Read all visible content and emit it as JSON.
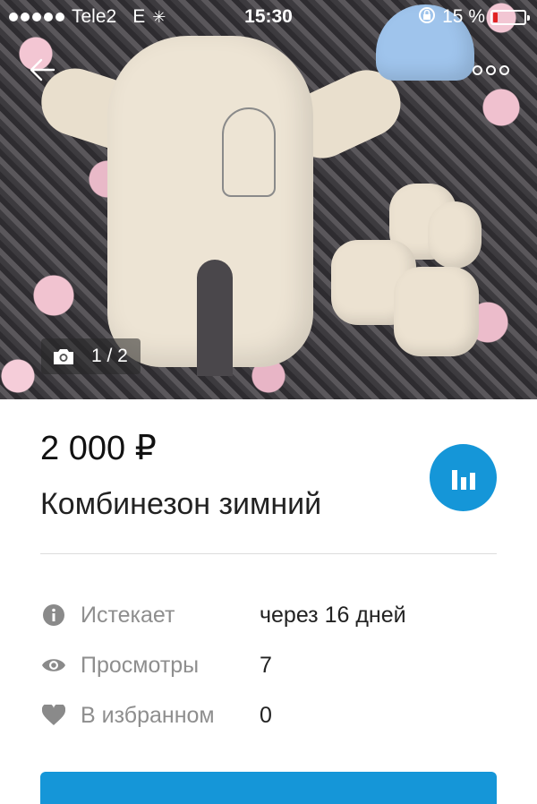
{
  "status_bar": {
    "carrier": "Tele2",
    "network": "E",
    "time": "15:30",
    "battery_percent_text": "15 %",
    "battery_level": 0.15,
    "signal_bars": 5
  },
  "photo": {
    "counter": "1 / 2"
  },
  "listing": {
    "price": "2 000 ₽",
    "title": "Комбинезон зимний"
  },
  "stats": [
    {
      "icon": "info-icon",
      "label": "Истекает",
      "value": "через 16 дней"
    },
    {
      "icon": "eye-icon",
      "label": "Просмотры",
      "value": "7"
    },
    {
      "icon": "heart-icon",
      "label": "В избранном",
      "value": "0"
    }
  ],
  "colors": {
    "accent": "#1596d8",
    "battery_low": "#e02424",
    "label_gray": "#8e8e8e"
  }
}
